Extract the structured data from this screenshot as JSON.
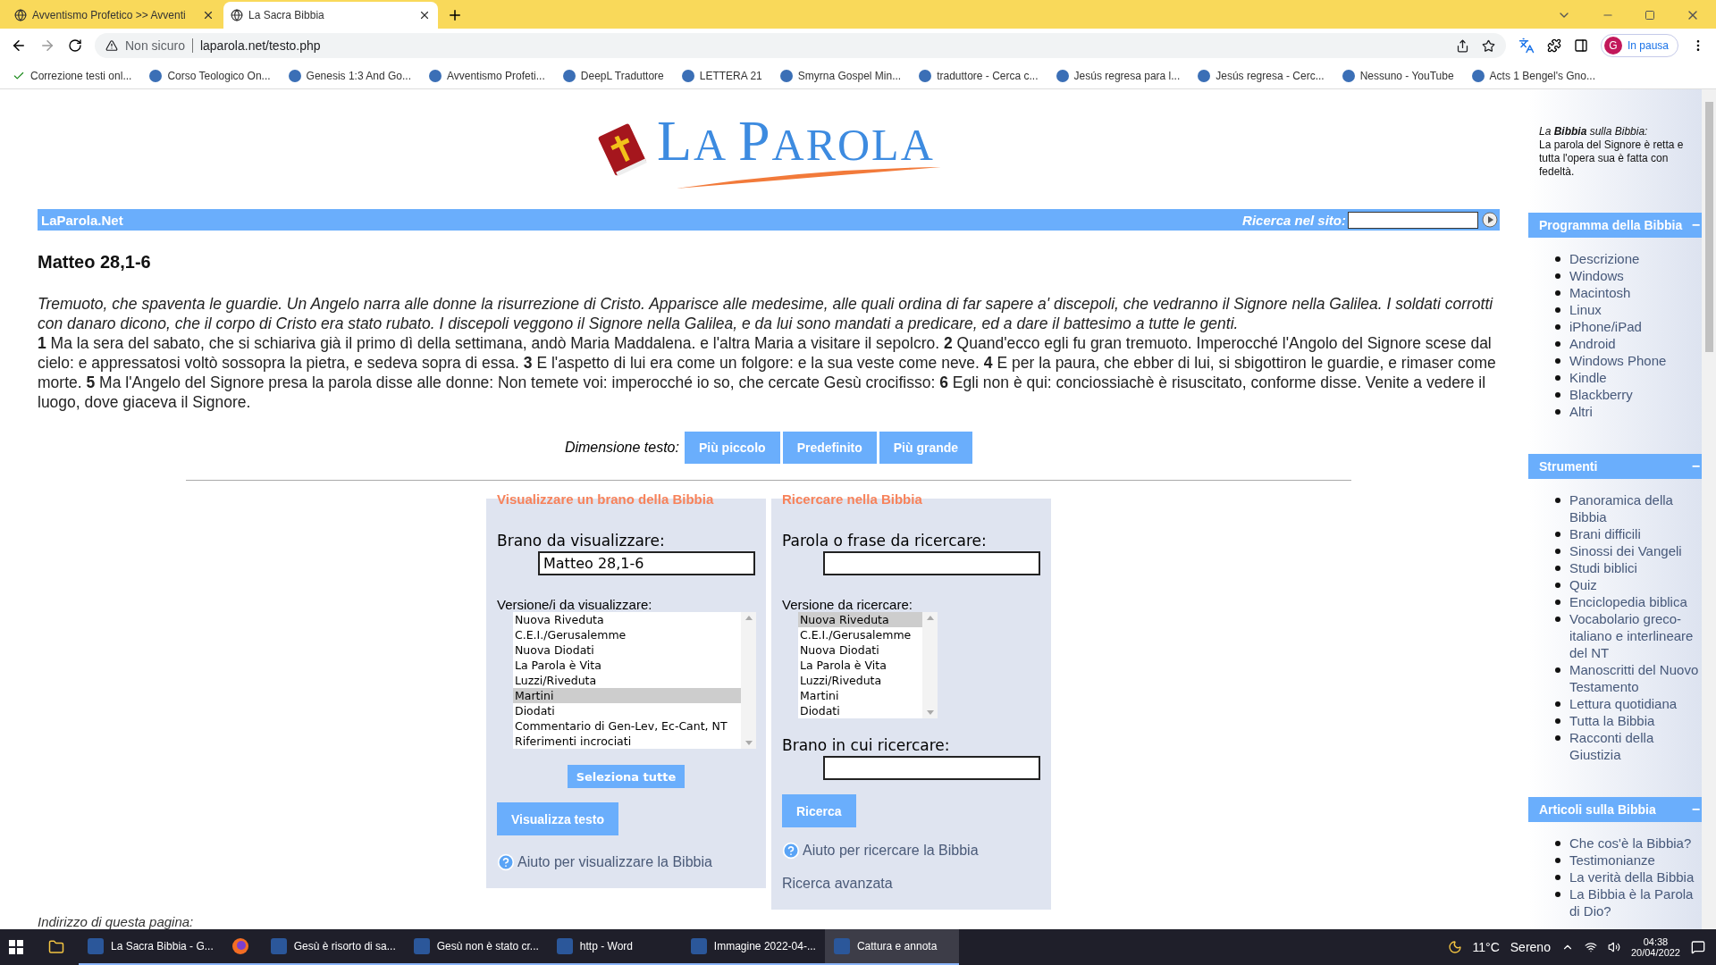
{
  "browser": {
    "tabs": [
      {
        "title": "Avventismo Profetico >> Avventi",
        "selected": false
      },
      {
        "title": "La Sacra Bibbia",
        "selected": true
      }
    ],
    "address": {
      "security": "Non sicuro",
      "url": "laparola.net/testo.php"
    },
    "profile": {
      "initial": "G",
      "status": "In pausa"
    },
    "bookmarks": [
      "Correzione testi onl...",
      "Corso Teologico On...",
      "Genesis 1:3 And Go...",
      "Avventismo Profeti...",
      "DeepL Traduttore",
      "LETTERA 21",
      "Smyrna Gospel Min...",
      "traduttore - Cerca c...",
      "Jesús regresa para l...",
      "Jesús regresa - Cerc...",
      "Nessuno - YouTube",
      "Acts 1 Bengel's Gno..."
    ]
  },
  "logo": {
    "title": "LA PAROLA"
  },
  "nav_bar": {
    "site": "LaParola.Net",
    "search_label": "Ricerca nel sito:"
  },
  "passage": {
    "title": "Matteo 28,1-6",
    "summary": "Tremuoto, che spaventa le guardie. Un Angelo narra alle donne la risurrezione di Cristo. Apparisce alle medesime, alle quali ordina di far sapere a' discepoli, che vedranno il Signore nella Galilea. I soldati corrotti con danaro dicono, che il corpo di Cristo era stato rubato. I discepoli veggono il Signore nella Galilea, e da lui sono mandati a predicare, ed a dare il battesimo a tutte le genti.",
    "verses": [
      {
        "number": "1",
        "text": "Ma la sera del sabato, che si schiariva già il primo dì della settimana, andò Maria Maddalena. e l'altra Maria a visitare il sepolcro."
      },
      {
        "number": "2",
        "text": "Quand'ecco egli fu gran tremuoto. Imperocché l'Angolo del Signore scese dal cielo: e appressatosi voltò sossopra la pietra, e sedeva sopra di essa."
      },
      {
        "number": "3",
        "text": "E l'aspetto di lui era come un folgore: e la sua veste come neve."
      },
      {
        "number": "4",
        "text": "E per la paura, che ebber di lui, si sbigottiron le guardie, e rimaser come morte."
      },
      {
        "number": "5",
        "text": "Ma l'Angelo del Signore presa la parola disse alle donne: Non temete voi: imperocché io so, che cercate Gesù crocifisso:"
      },
      {
        "number": "6",
        "text": "Egli non è qui: conciossiachè è risuscitato, conforme disse. Venite a vedere il luogo, dove giaceva il Signore."
      }
    ]
  },
  "text_size": {
    "label": "Dimensione testo:",
    "buttons": [
      "Più piccolo",
      "Predefinito",
      "Più grande"
    ]
  },
  "view_panel": {
    "heading": "Visualizzare un brano della Bibbia",
    "passage_label": "Brano da visualizzare:",
    "passage_value": "Matteo 28,1-6",
    "versions_label": "Versione/i da visualizzare:",
    "versions": [
      {
        "label": "Nuova Riveduta",
        "selected": false
      },
      {
        "label": "C.E.I./Gerusalemme",
        "selected": false
      },
      {
        "label": "Nuova Diodati",
        "selected": false
      },
      {
        "label": "La Parola è Vita",
        "selected": false
      },
      {
        "label": "Luzzi/Riveduta",
        "selected": false
      },
      {
        "label": "Martini",
        "selected": true
      },
      {
        "label": "Diodati",
        "selected": false
      },
      {
        "label": "Commentario di Gen-Lev, Ec-Cant, NT",
        "selected": false
      },
      {
        "label": "Riferimenti incrociati",
        "selected": false
      }
    ],
    "select_all": "Seleziona tutte",
    "submit": "Visualizza testo",
    "help": "Aiuto per visualizzare la Bibbia"
  },
  "search_panel": {
    "heading": "Ricercare nella Bibbia",
    "phrase_label": "Parola o frase da ricercare:",
    "versions_label": "Versione da ricercare:",
    "versions": [
      {
        "label": "Nuova Riveduta",
        "selected": true
      },
      {
        "label": "C.E.I./Gerusalemme",
        "selected": false
      },
      {
        "label": "Nuova Diodati",
        "selected": false
      },
      {
        "label": "La Parola è Vita",
        "selected": false
      },
      {
        "label": "Luzzi/Riveduta",
        "selected": false
      },
      {
        "label": "Martini",
        "selected": false
      },
      {
        "label": "Diodati",
        "selected": false
      }
    ],
    "range_label": "Brano in cui ricercare:",
    "submit": "Ricerca",
    "help": "Aiuto per ricercare la Bibbia",
    "advanced": "Ricerca avanzata"
  },
  "footer_text": "Indirizzo di questa pagina:",
  "sidebar": {
    "quote_title": "La **Bibbia** sulla Bibbia:",
    "quote": "La parola del Signore è retta e tutta l'opera sua è fatta con fedeltà.",
    "sections": [
      {
        "title": "Programma della Bibbia",
        "toggle": "−",
        "links": [
          "Descrizione",
          "Windows",
          "Macintosh",
          "Linux",
          "iPhone/iPad",
          "Android",
          "Windows Phone",
          "Kindle",
          "Blackberry",
          "Altri"
        ]
      },
      {
        "title": "Strumenti",
        "toggle": "−",
        "links": [
          "Panoramica della Bibbia",
          "Brani difficili",
          "Sinossi dei Vangeli",
          "Studi biblici",
          "Quiz",
          "Enciclopedia biblica",
          "Vocabolario greco-italiano e interlineare del NT",
          "Manoscritti del Nuovo Testamento",
          "Lettura quotidiana",
          "Tutta la Bibbia",
          "Racconti della Giustizia"
        ]
      },
      {
        "title": "Articoli sulla Bibbia",
        "toggle": "−",
        "links": [
          "Che cos'è la Bibbia?",
          "Testimonianze",
          "La verità della Bibbia",
          "La Bibbia è la Parola di Dio?"
        ]
      }
    ]
  },
  "taskbar": {
    "items": [
      {
        "label": "La Sacra Bibbia - G...",
        "selected": false
      },
      {
        "label": "Gesù è risorto di sa...",
        "selected": false
      },
      {
        "label": "Gesù non è stato cr...",
        "selected": false
      },
      {
        "label": "http - Word",
        "selected": false
      },
      {
        "label": "Immagine 2022-04-...",
        "selected": false
      },
      {
        "label": "Cattura e annota",
        "selected": true
      }
    ],
    "weather": {
      "temp": "11°C",
      "condition": "Sereno"
    },
    "clock": {
      "time": "04:38",
      "date": "20/04/2022"
    }
  }
}
